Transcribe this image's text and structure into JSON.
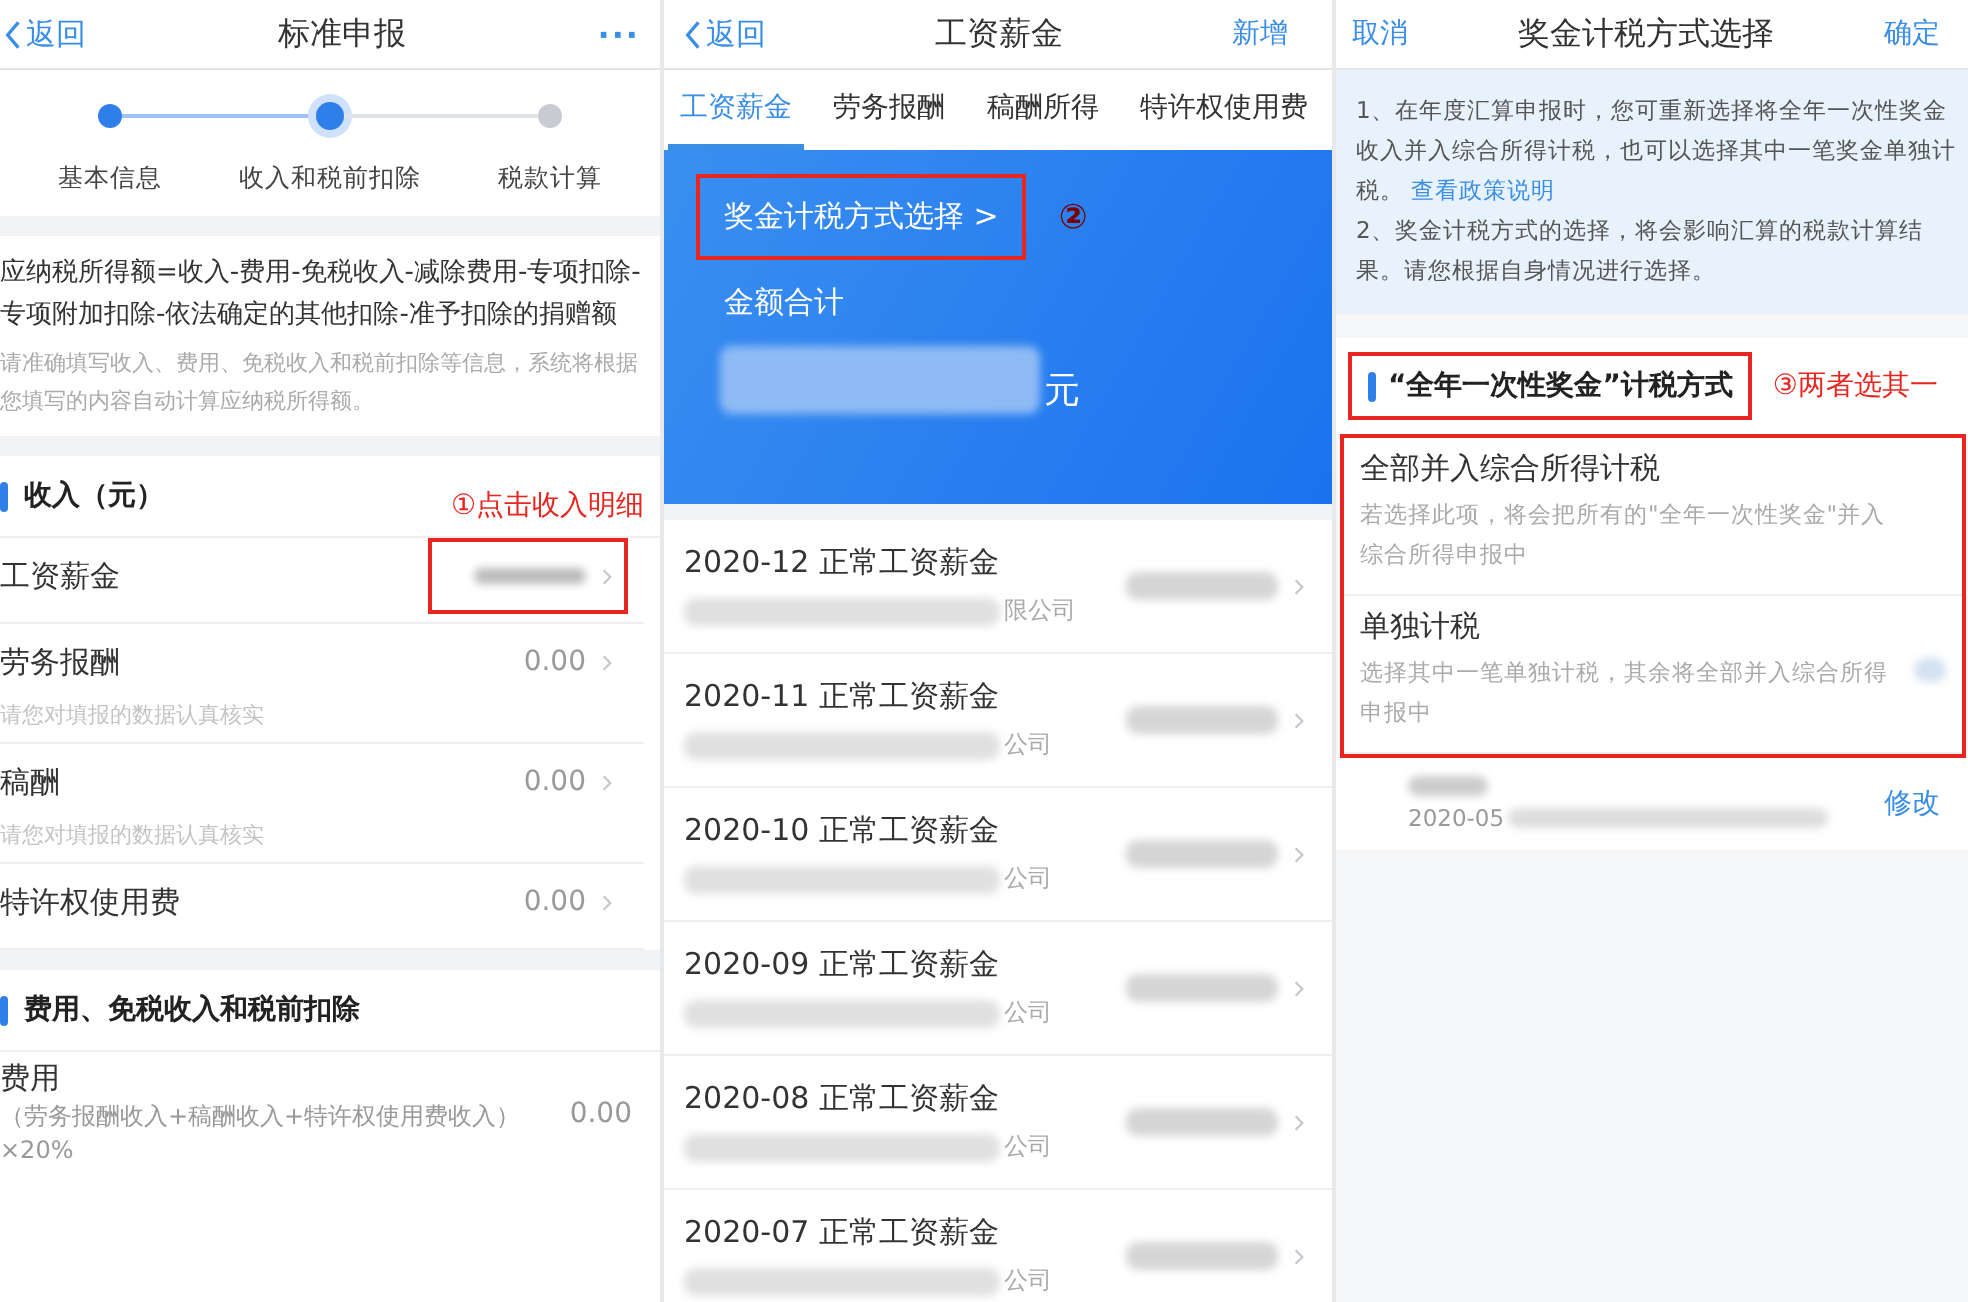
{
  "standard_report": {
    "header": {
      "back": "返回",
      "title": "标准申报",
      "more": "···"
    },
    "steps": [
      {
        "label": "基本信息",
        "reached": true,
        "selected": false
      },
      {
        "label": "收入和税前扣除",
        "reached": true,
        "selected": true
      },
      {
        "label": "税款计算",
        "reached": false,
        "selected": false
      }
    ],
    "formula": "应纳税所得额=收入-费用-免税收入-减除费用-专项扣除-专项附加扣除-依法确定的其他扣除-准予扣除的捐赠额",
    "hint": "请准确填写收入、费用、免税收入和税前扣除等信息，系统将根据您填写的内容自动计算应纳税所得额。",
    "income_section": {
      "title": "收入（元）",
      "annotation": "①点击收入明细",
      "rows": [
        {
          "label": "工资薪金",
          "kind": "blurred",
          "highlighted": true
        },
        {
          "label": "劳务报酬",
          "kind": "amount",
          "value": "0.00",
          "hint": "请您对填报的数据认真核实",
          "highlighted": false
        },
        {
          "label": "稿酬",
          "kind": "amount",
          "value": "0.00",
          "hint": "请您对填报的数据认真核实",
          "highlighted": false
        },
        {
          "label": "特许权使用费",
          "kind": "amount",
          "value": "0.00",
          "highlighted": false
        }
      ]
    },
    "expense_section": {
      "title": "费用、免税收入和税前扣除",
      "rows": [
        {
          "label": "费用",
          "note": "（劳务报酬收入+稿酬收入+特许权使用费收入）×20%",
          "value": "0.00"
        }
      ]
    }
  },
  "salary_list": {
    "header": {
      "back": "返回",
      "title": "工资薪金",
      "action": "新增"
    },
    "tabs": [
      {
        "label": "工资薪金",
        "selected": true
      },
      {
        "label": "劳务报酬",
        "selected": false
      },
      {
        "label": "稿酬所得",
        "selected": false
      },
      {
        "label": "特许权使用费",
        "selected": false
      }
    ],
    "card": {
      "link": "奖金计税方式选择 >",
      "annotation": "②",
      "highlighted": true,
      "total_label": "金额合计",
      "unit": "元"
    },
    "records": [
      {
        "title": "2020-12 正常工资薪金",
        "company_tail": "限公司"
      },
      {
        "title": "2020-11 正常工资薪金",
        "company_tail": "公司"
      },
      {
        "title": "2020-10 正常工资薪金",
        "company_tail": "公司"
      },
      {
        "title": "2020-09 正常工资薪金",
        "company_tail": "公司"
      },
      {
        "title": "2020-08 正常工资薪金",
        "company_tail": "公司"
      },
      {
        "title": "2020-07 正常工资薪金",
        "company_tail": "公司"
      }
    ]
  },
  "bonus_method": {
    "header": {
      "cancel": "取消",
      "title": "奖金计税方式选择",
      "confirm": "确定"
    },
    "notice": {
      "paragraph_1": "1、在年度汇算申报时，您可重新选择将全年一次性奖金收入并入综合所得计税，也可以选择其中一笔奖金单独计税。",
      "link": "查看政策说明",
      "paragraph_2": "2、奖金计税方式的选择，将会影响汇算的税款计算结果。请您根据自身情况进行选择。"
    },
    "section": {
      "title": "“全年一次性奖金”计税方式",
      "annotation": "③两者选其一",
      "highlighted": true
    },
    "options_highlighted": true,
    "options": [
      {
        "title": "全部并入综合所得计税",
        "desc": "若选择此项，将会把所有的\"全年一次性奖金\"并入综合所得申报中"
      },
      {
        "title": "单独计税",
        "desc": "选择其中一笔单独计税，其余将全部并入综合所得申报中"
      }
    ],
    "entry": {
      "date": "2020-05",
      "action": "修改"
    }
  }
}
